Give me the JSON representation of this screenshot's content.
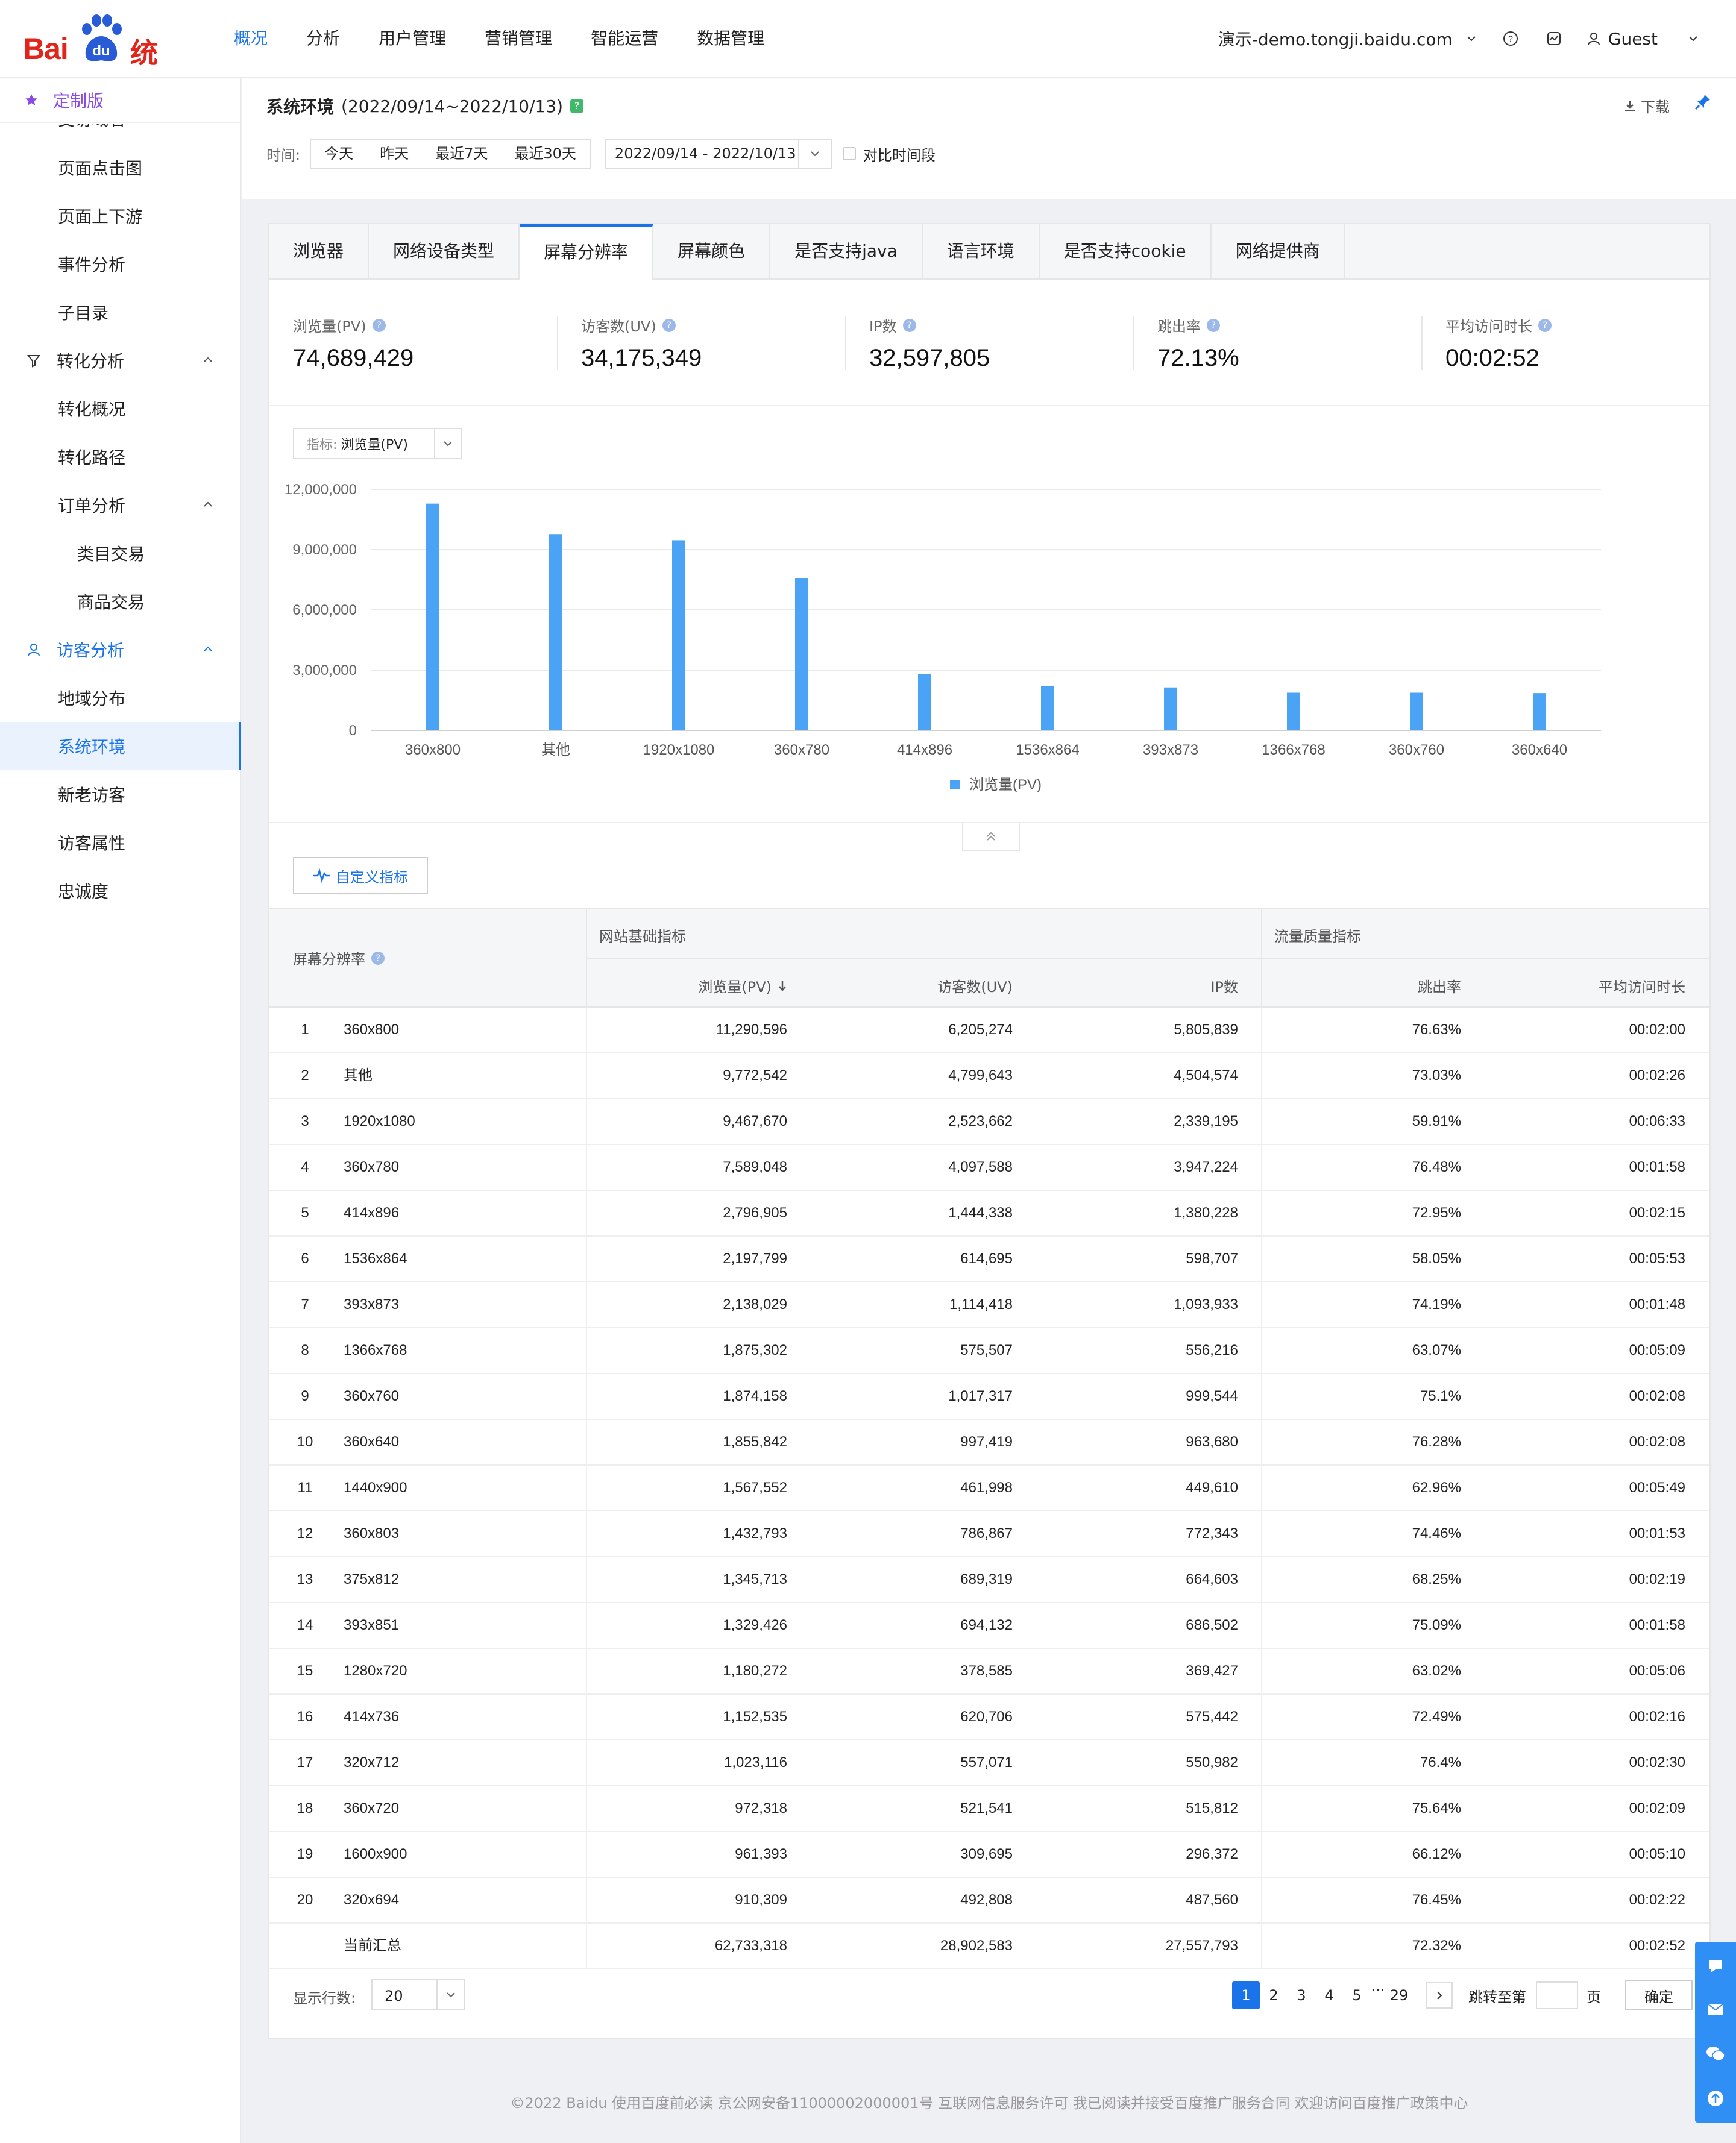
{
  "brand": {
    "logo_bai": "Bai",
    "logo_du": "du",
    "logo_tongji": "统计"
  },
  "nav": {
    "items": [
      "概况",
      "分析",
      "用户管理",
      "营销管理",
      "智能运营",
      "数据管理"
    ],
    "active": "概况",
    "site": "演示-demo.tongji.baidu.com",
    "user": "Guest"
  },
  "sidebar": {
    "header": "定制版",
    "truncated_item": "受访域名",
    "items": [
      {
        "label": "页面点击图"
      },
      {
        "label": "页面上下游"
      },
      {
        "label": "事件分析"
      },
      {
        "label": "子目录"
      },
      {
        "label": "转化分析"
      },
      {
        "label": "转化概况"
      },
      {
        "label": "转化路径"
      },
      {
        "label": "订单分析"
      },
      {
        "label": "类目交易"
      },
      {
        "label": "商品交易"
      },
      {
        "label": "访客分析"
      },
      {
        "label": "地域分布"
      },
      {
        "label": "系统环境"
      },
      {
        "label": "新老访客"
      },
      {
        "label": "访客属性"
      },
      {
        "label": "忠诚度"
      }
    ]
  },
  "page": {
    "title": "系统环境",
    "date_range": "(2022/09/14~2022/10/13)",
    "help_mark": "?",
    "download": "下载",
    "time_label": "时间:",
    "quick_ranges": [
      "今天",
      "昨天",
      "最近7天",
      "最近30天"
    ],
    "date_picker": "2022/09/14 - 2022/10/13",
    "compare_label": "对比时间段"
  },
  "tabs": [
    "浏览器",
    "网络设备类型",
    "屏幕分辨率",
    "屏幕颜色",
    "是否支持java",
    "语言环境",
    "是否支持cookie",
    "网络提供商"
  ],
  "active_tab": "屏幕分辨率",
  "kpis": [
    {
      "label": "浏览量(PV)",
      "value": "74,689,429"
    },
    {
      "label": "访客数(UV)",
      "value": "34,175,349"
    },
    {
      "label": "IP数",
      "value": "32,597,805"
    },
    {
      "label": "跳出率",
      "value": "72.13%"
    },
    {
      "label": "平均访问时长",
      "value": "00:02:52"
    }
  ],
  "metric_selector": {
    "label": "指标:",
    "value": "浏览量(PV)"
  },
  "chart_data": {
    "type": "bar",
    "categories": [
      "360x800",
      "其他",
      "1920x1080",
      "360x780",
      "414x896",
      "1536x864",
      "393x873",
      "1366x768",
      "360x760",
      "360x640"
    ],
    "series": [
      {
        "name": "浏览量(PV)",
        "values": [
          11290596,
          9772542,
          9467670,
          7589048,
          2796905,
          2197799,
          2138029,
          1875302,
          1874158,
          1855842
        ]
      }
    ],
    "y_ticks": [
      "12,000,000",
      "9,000,000",
      "6,000,000",
      "3,000,000",
      "0"
    ],
    "ylim": [
      0,
      12000000
    ],
    "legend": "bottom-center",
    "color": "#4ba3f5"
  },
  "custom_metrics_button": "自定义指标",
  "table": {
    "dim_header": "屏幕分辨率",
    "group1": "网站基础指标",
    "group2": "流量质量指标",
    "columns": [
      "浏览量(PV)",
      "访客数(UV)",
      "IP数",
      "跳出率",
      "平均访问时长"
    ],
    "rows": [
      {
        "idx": "1",
        "name": "360x800",
        "pv": "11,290,596",
        "uv": "6,205,274",
        "ip": "5,805,839",
        "br": "76.63%",
        "dur": "00:02:00"
      },
      {
        "idx": "2",
        "name": "其他",
        "pv": "9,772,542",
        "uv": "4,799,643",
        "ip": "4,504,574",
        "br": "73.03%",
        "dur": "00:02:26"
      },
      {
        "idx": "3",
        "name": "1920x1080",
        "pv": "9,467,670",
        "uv": "2,523,662",
        "ip": "2,339,195",
        "br": "59.91%",
        "dur": "00:06:33"
      },
      {
        "idx": "4",
        "name": "360x780",
        "pv": "7,589,048",
        "uv": "4,097,588",
        "ip": "3,947,224",
        "br": "76.48%",
        "dur": "00:01:58"
      },
      {
        "idx": "5",
        "name": "414x896",
        "pv": "2,796,905",
        "uv": "1,444,338",
        "ip": "1,380,228",
        "br": "72.95%",
        "dur": "00:02:15"
      },
      {
        "idx": "6",
        "name": "1536x864",
        "pv": "2,197,799",
        "uv": "614,695",
        "ip": "598,707",
        "br": "58.05%",
        "dur": "00:05:53"
      },
      {
        "idx": "7",
        "name": "393x873",
        "pv": "2,138,029",
        "uv": "1,114,418",
        "ip": "1,093,933",
        "br": "74.19%",
        "dur": "00:01:48"
      },
      {
        "idx": "8",
        "name": "1366x768",
        "pv": "1,875,302",
        "uv": "575,507",
        "ip": "556,216",
        "br": "63.07%",
        "dur": "00:05:09"
      },
      {
        "idx": "9",
        "name": "360x760",
        "pv": "1,874,158",
        "uv": "1,017,317",
        "ip": "999,544",
        "br": "75.1%",
        "dur": "00:02:08"
      },
      {
        "idx": "10",
        "name": "360x640",
        "pv": "1,855,842",
        "uv": "997,419",
        "ip": "963,680",
        "br": "76.28%",
        "dur": "00:02:08"
      },
      {
        "idx": "11",
        "name": "1440x900",
        "pv": "1,567,552",
        "uv": "461,998",
        "ip": "449,610",
        "br": "62.96%",
        "dur": "00:05:49"
      },
      {
        "idx": "12",
        "name": "360x803",
        "pv": "1,432,793",
        "uv": "786,867",
        "ip": "772,343",
        "br": "74.46%",
        "dur": "00:01:53"
      },
      {
        "idx": "13",
        "name": "375x812",
        "pv": "1,345,713",
        "uv": "689,319",
        "ip": "664,603",
        "br": "68.25%",
        "dur": "00:02:19"
      },
      {
        "idx": "14",
        "name": "393x851",
        "pv": "1,329,426",
        "uv": "694,132",
        "ip": "686,502",
        "br": "75.09%",
        "dur": "00:01:58"
      },
      {
        "idx": "15",
        "name": "1280x720",
        "pv": "1,180,272",
        "uv": "378,585",
        "ip": "369,427",
        "br": "63.02%",
        "dur": "00:05:06"
      },
      {
        "idx": "16",
        "name": "414x736",
        "pv": "1,152,535",
        "uv": "620,706",
        "ip": "575,442",
        "br": "72.49%",
        "dur": "00:02:16"
      },
      {
        "idx": "17",
        "name": "320x712",
        "pv": "1,023,116",
        "uv": "557,071",
        "ip": "550,982",
        "br": "76.4%",
        "dur": "00:02:30"
      },
      {
        "idx": "18",
        "name": "360x720",
        "pv": "972,318",
        "uv": "521,541",
        "ip": "515,812",
        "br": "75.64%",
        "dur": "00:02:09"
      },
      {
        "idx": "19",
        "name": "1600x900",
        "pv": "961,393",
        "uv": "309,695",
        "ip": "296,372",
        "br": "66.12%",
        "dur": "00:05:10"
      },
      {
        "idx": "20",
        "name": "320x694",
        "pv": "910,309",
        "uv": "492,808",
        "ip": "487,560",
        "br": "76.45%",
        "dur": "00:02:22"
      }
    ],
    "summary": {
      "name": "当前汇总",
      "pv": "62,733,318",
      "uv": "28,902,583",
      "ip": "27,557,793",
      "br": "72.32%",
      "dur": "00:02:52"
    }
  },
  "pager": {
    "rows_label": "显示行数:",
    "rows_value": "20",
    "pages": [
      "1",
      "2",
      "3",
      "4",
      "5"
    ],
    "ellipsis": "···",
    "last_page": "29",
    "jump_label": "跳转至第",
    "page_word": "页",
    "ok": "确定"
  },
  "footer": "©2022 Baidu 使用百度前必读 京公网安备11000002000001号 互联网信息服务许可 我已阅读并接受百度推广服务合同 欢迎访问百度推广政策中心"
}
